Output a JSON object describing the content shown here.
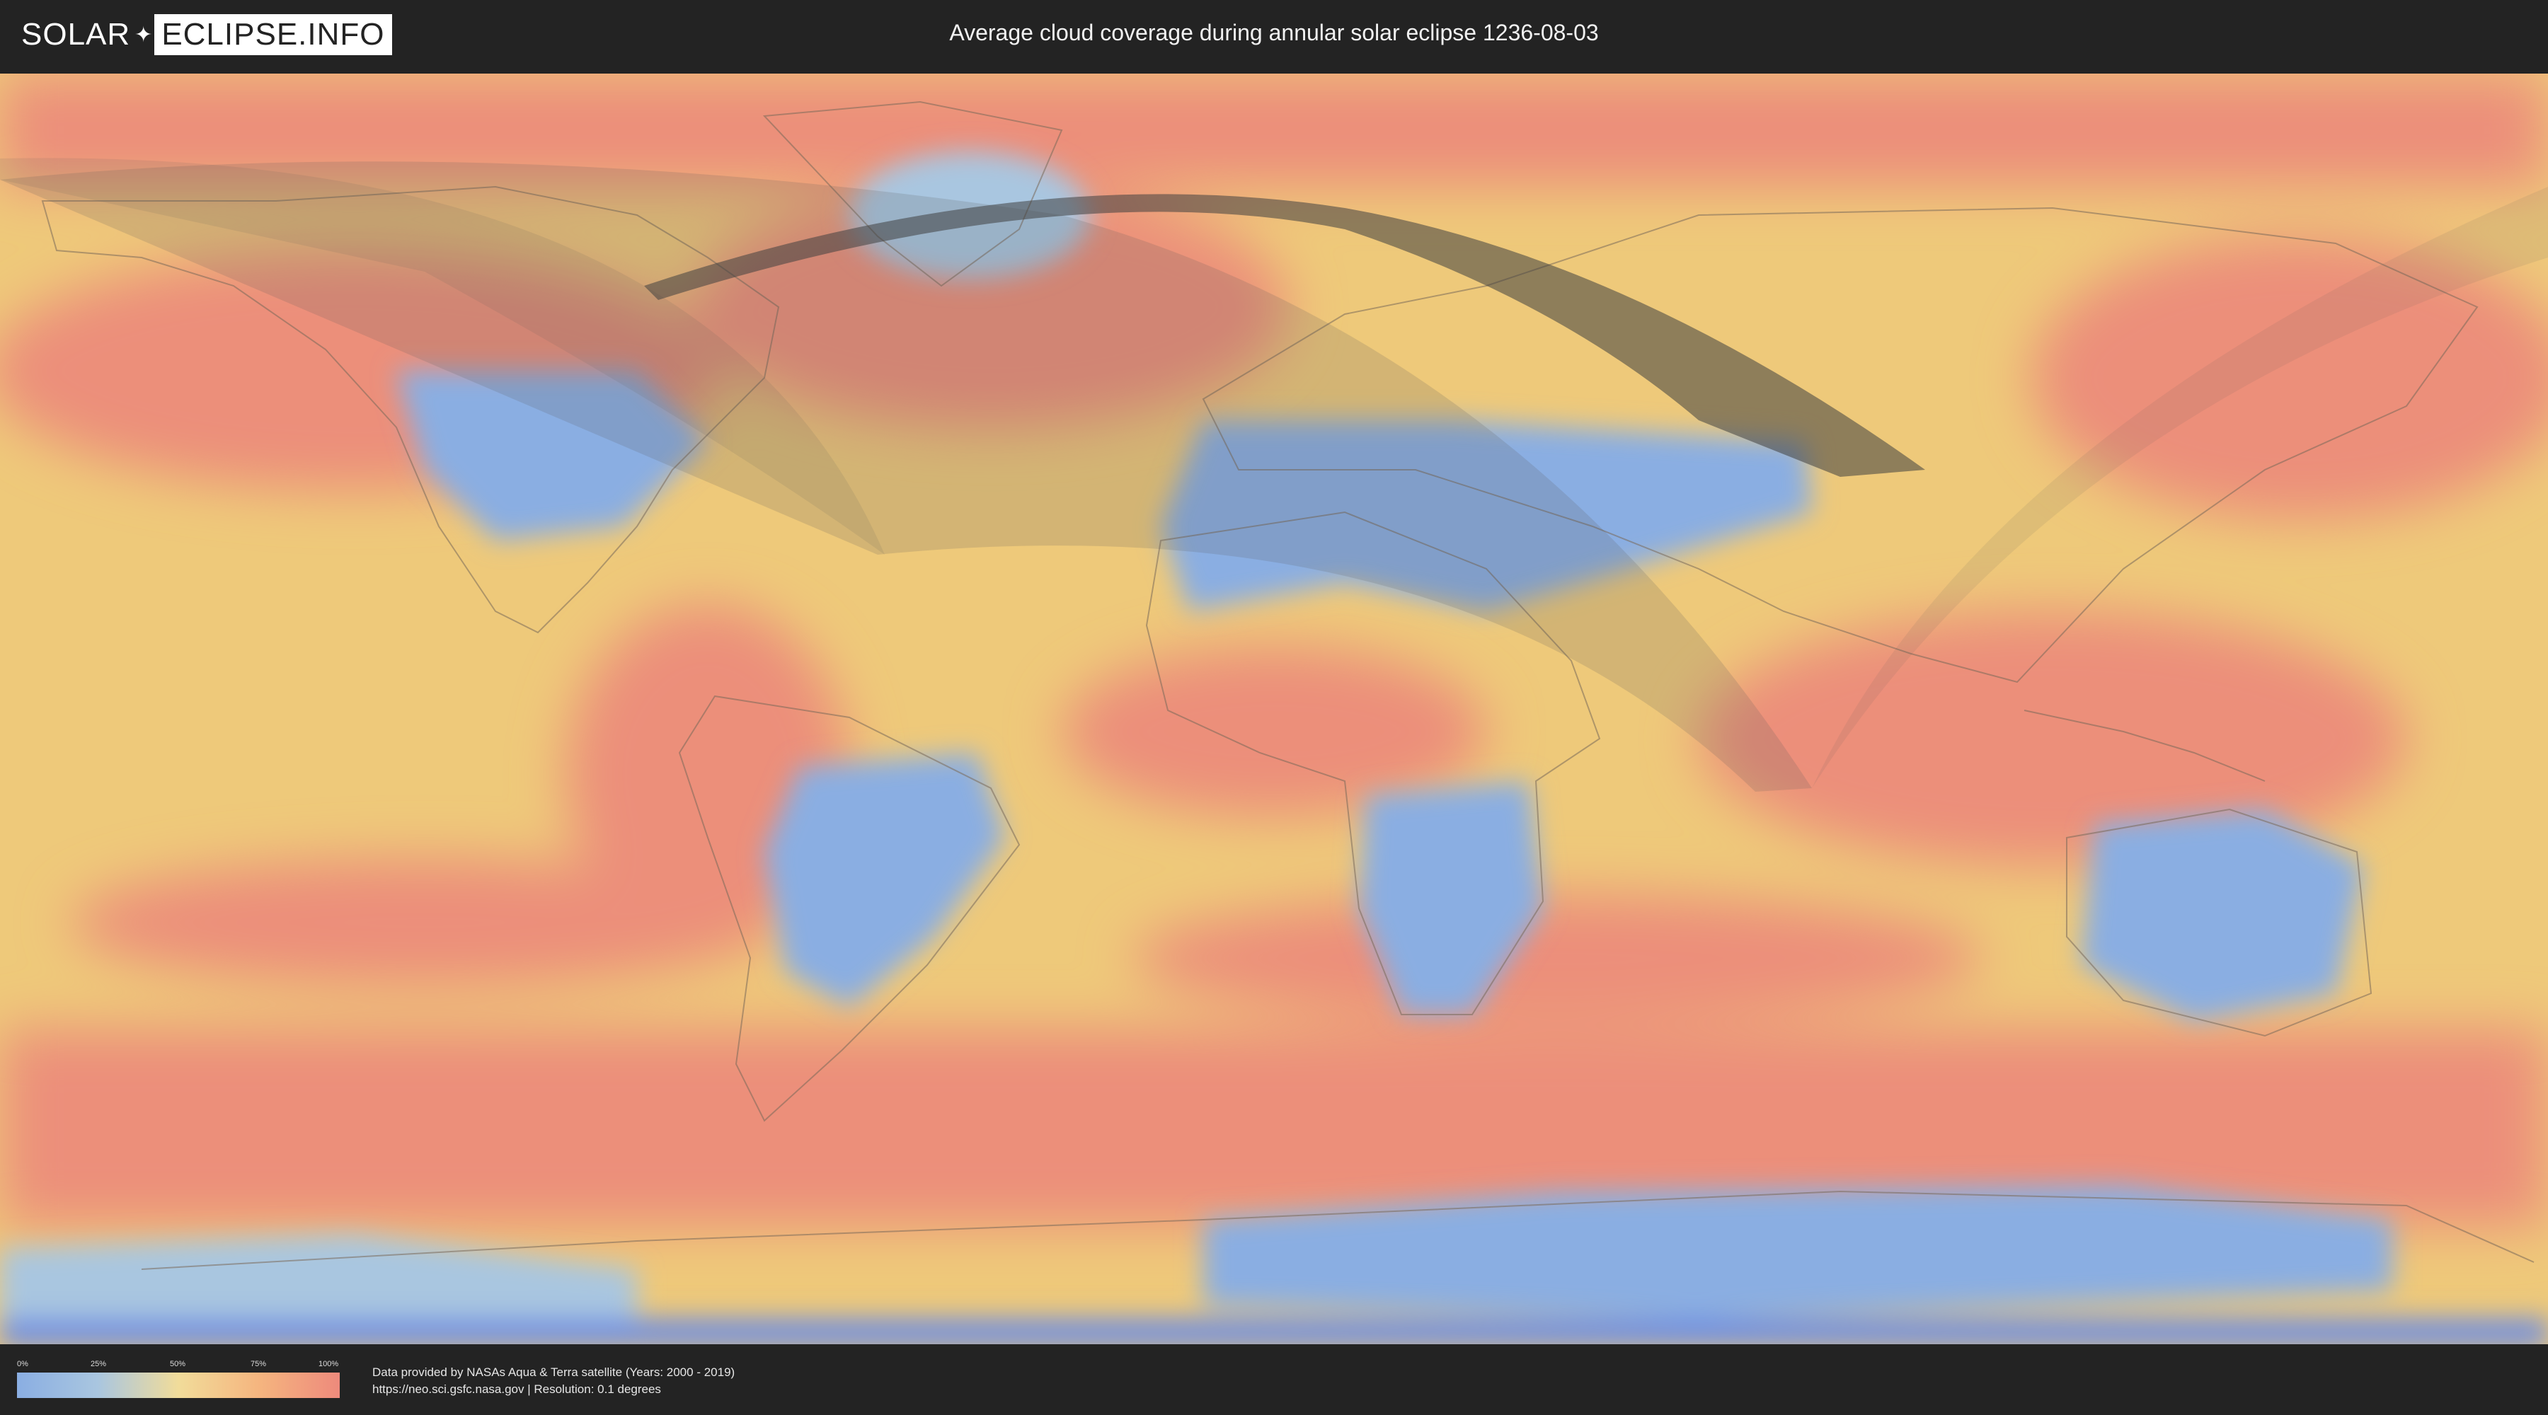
{
  "header": {
    "logo_left": "SOLAR",
    "logo_right": "ECLIPSE.INFO",
    "title": "Average cloud coverage during annular solar eclipse 1236-08-03"
  },
  "legend": {
    "ticks": [
      "0%",
      "25%",
      "50%",
      "75%",
      "100%"
    ],
    "colors": [
      "#8aaee2",
      "#a9c6e0",
      "#f1dc9a",
      "#f5b57f",
      "#ee8a7c"
    ]
  },
  "footer": {
    "line1": "Data provided by NASAs Aqua & Terra satellite (Years: 2000 - 2019)",
    "line2": "https://neo.sci.gsfc.nasa.gov | Resolution: 0.1 degrees"
  },
  "map": {
    "low_cloud_color": "#8aaee2",
    "high_cloud_color": "#ee8a7c",
    "mid_cloud_color": "#f1dc9a",
    "path_color": "#3f3f3f"
  }
}
